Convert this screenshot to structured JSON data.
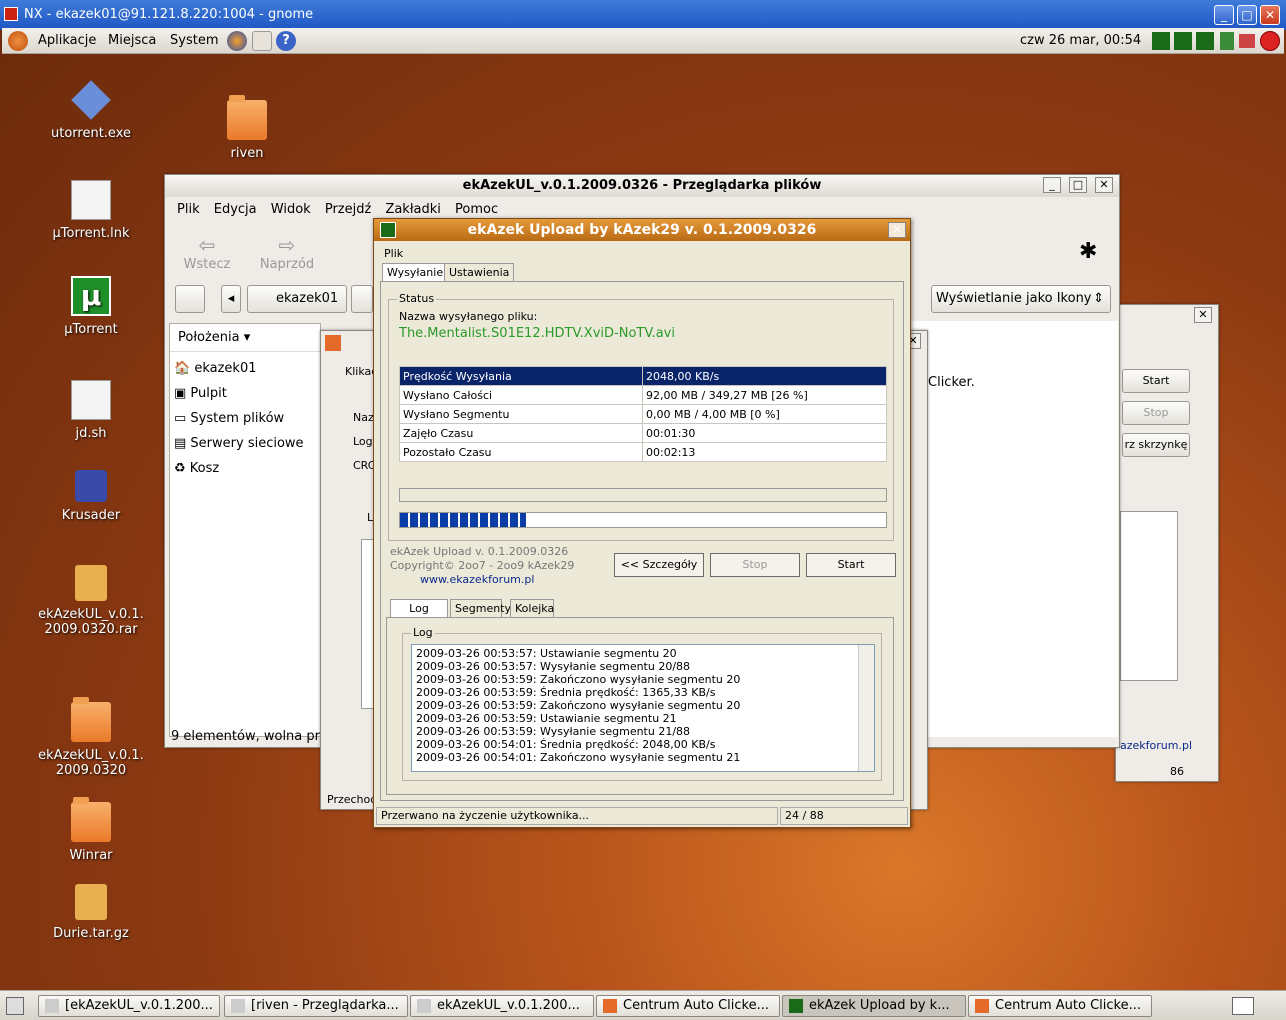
{
  "nx": {
    "title": "NX - ekazek01@91.121.8.220:1004 - gnome"
  },
  "panel": {
    "menus": [
      "Aplikacje",
      "Miejsca",
      "System"
    ],
    "clock": "czw 26 mar, 00:54"
  },
  "desktop": {
    "icons": [
      {
        "label": "utorrent.exe"
      },
      {
        "label": "riven"
      },
      {
        "label": "µTorrent.lnk"
      },
      {
        "label": "µTorrent"
      },
      {
        "label": "jd.sh"
      },
      {
        "label": "Krusader"
      },
      {
        "label": "ekAzekUL_v.0.1.2009.0320.rar"
      },
      {
        "label": "ekAzekUL_v.0.1.2009.0320"
      },
      {
        "label": "Winrar"
      },
      {
        "label": "Durie.tar.gz"
      }
    ]
  },
  "browser": {
    "title": "ekAzekUL_v.0.1.2009.0326 - Przeglądarka plików",
    "menu": [
      "Plik",
      "Edycja",
      "Widok",
      "Przejdź",
      "Zakładki",
      "Pomoc"
    ],
    "back": "Wstecz",
    "forward": "Naprzód",
    "crumb": "ekazek01",
    "view": "Wyświetlanie jako Ikony",
    "places_header": "Położenia",
    "places": [
      "ekazek01",
      "Pulpit",
      "System plików",
      "Serwery sieciowe",
      "Kosz"
    ],
    "status": "9 elementów, wolna prz"
  },
  "clicker": {
    "text": "Clicker.",
    "start": "Start",
    "stop": "Stop",
    "tray": "rz skrzynkę",
    "link": "azekforum.pl",
    "count": "86",
    "left_labels": [
      "Klikac",
      "Naz",
      "Logi",
      "CRC",
      "L",
      "Przechod"
    ]
  },
  "ek": {
    "title": "ekAzek Upload by kAzek29 v. 0.1.2009.0326",
    "menu": "Plik",
    "tabs": [
      "Wysyłanie",
      "Ustawienia"
    ],
    "status_group": "Status",
    "file_label": "Nazwa wysyłanego pliku:",
    "file_name": "The.Mentalist.S01E12.HDTV.XviD-NoTV.avi",
    "rows": [
      [
        "Prędkość Wysyłania",
        "2048,00 KB/s"
      ],
      [
        "Wysłano Całości",
        "92,00 MB / 349,27 MB  [26 %]"
      ],
      [
        "Wysłano Segmentu",
        "0,00 MB / 4,00 MB  [0 %]"
      ],
      [
        "Zajęło Czasu",
        "00:01:30"
      ],
      [
        "Pozostało Czasu",
        "00:02:13"
      ]
    ],
    "progress": 0.26,
    "version": "ekAzek Upload v. 0.1.2009.0326",
    "copyright": "Copyright© 2oo7 - 2oo9 kAzek29",
    "link": "www.ekazekforum.pl",
    "btn_details": "<< Szczegóły",
    "btn_stop": "Stop",
    "btn_start": "Start",
    "log_tabs": [
      "Log",
      "Segmenty",
      "Kolejka"
    ],
    "log_group": "Log",
    "log": [
      "2009-03-26 00:53:57: Ustawianie segmentu 20",
      "2009-03-26 00:53:57: Wysyłanie segmentu 20/88",
      "2009-03-26 00:53:59: Zakończono wysyłanie segmentu 20",
      "2009-03-26 00:53:59: Średnia prędkość: 1365,33 KB/s",
      "2009-03-26 00:53:59: Zakończono wysyłanie segmentu 20",
      "2009-03-26 00:53:59: Ustawianie segmentu 21",
      "2009-03-26 00:53:59: Wysyłanie segmentu 21/88",
      "2009-03-26 00:54:01: Średnia prędkość: 2048,00 KB/s",
      "2009-03-26 00:54:01: Zakończono wysyłanie segmentu 21"
    ],
    "statusbar": "Przerwano na życzenie użytkownika...",
    "segments": "24 / 88"
  },
  "taskbar": [
    "[ekAzekUL_v.0.1.200...",
    "[riven - Przeglądarka...",
    "ekAzekUL_v.0.1.200...",
    "Centrum Auto Clicke...",
    "ekAzek Upload by k...",
    "Centrum Auto Clicke..."
  ],
  "colors": {
    "ek_title": "#c4761c",
    "selected_row": "#0a246a",
    "progress": "#0a3ea8",
    "filename": "#2a9a2a"
  }
}
